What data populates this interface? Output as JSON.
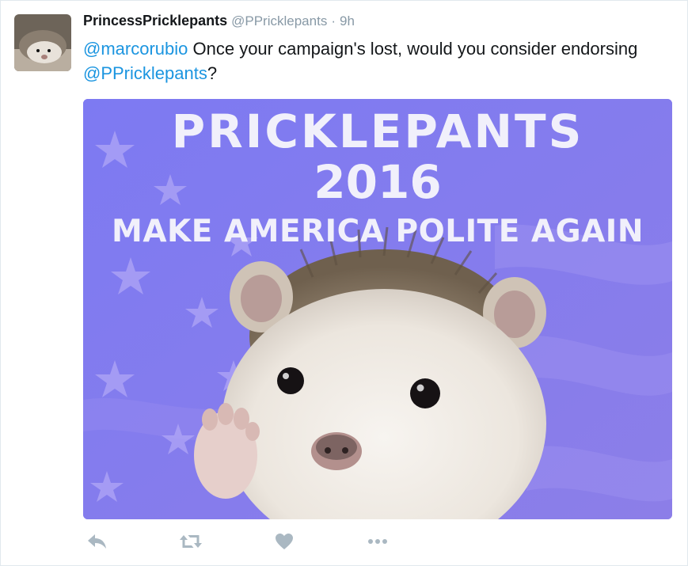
{
  "tweet": {
    "author_name": "PrincessPricklepants",
    "author_handle": "@PPricklepants",
    "separator": "·",
    "timestamp": "9h",
    "text_mention_1": "@marcorubio",
    "text_part_1": " Once your campaign's lost, would you consider endorsing ",
    "text_mention_2": "@PPricklepants",
    "text_part_2": "?"
  },
  "media": {
    "poster_title": "PRICKLEPANTS",
    "poster_year": "2016",
    "poster_slogan": "MAKE AMERICA POLITE AGAIN"
  },
  "actions": {
    "reply_icon": "reply-icon",
    "retweet_icon": "retweet-icon",
    "like_icon": "heart-icon",
    "more_icon": "more-icon"
  },
  "colors": {
    "link": "#1b95e0",
    "muted": "#8899a6",
    "poster_bg": "#7f78f0",
    "action_icon": "#aab8c2"
  }
}
